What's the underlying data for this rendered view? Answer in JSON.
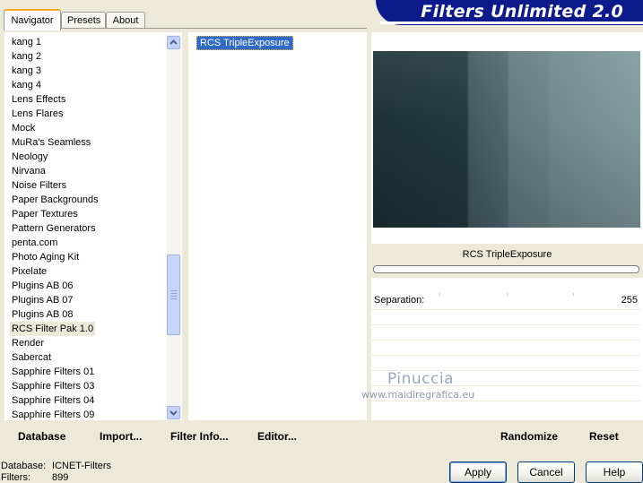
{
  "tabs": [
    "Navigator",
    "Presets",
    "About"
  ],
  "banner_title": "Filters Unlimited 2.0",
  "categories": [
    "kang 1",
    "kang 2",
    "kang 3",
    "kang 4",
    "Lens Effects",
    "Lens Flares",
    "Mock",
    "MuRa's Seamless",
    "Neology",
    "Nirvana",
    "Noise Filters",
    "Paper Backgrounds",
    "Paper Textures",
    "Pattern Generators",
    "penta.com",
    "Photo Aging Kit",
    "Pixelate",
    "Plugins AB 06",
    "Plugins AB 07",
    "Plugins AB 08",
    "RCS Filter Pak 1.0",
    "Render",
    "Sabercat",
    "Sapphire Filters 01",
    "Sapphire Filters 03",
    "Sapphire Filters 04",
    "Sapphire Filters 09"
  ],
  "selected_category": "RCS Filter Pak 1.0",
  "filters": [
    "RCS TripleExposure"
  ],
  "preview": {
    "filter_name": "RCS TripleExposure"
  },
  "controls": [
    {
      "label": "Separation:",
      "value": "255"
    }
  ],
  "watermark": {
    "name": "Pinuccia",
    "site": "www.maidiregrafica.eu"
  },
  "actions": {
    "database": "Database",
    "import": "Import...",
    "filter_info": "Filter Info...",
    "editor": "Editor...",
    "randomize": "Randomize",
    "reset": "Reset"
  },
  "status": {
    "database_label": "Database:",
    "database_value": "ICNET-Filters",
    "filters_label": "Filters:",
    "filters_value": "899"
  },
  "dialog_buttons": {
    "apply": "Apply",
    "cancel": "Cancel",
    "help": "Help"
  },
  "colors": {
    "banner": "#0c1a8c",
    "selection": "#316ac5",
    "active_tab_accent": "#f5a623"
  }
}
